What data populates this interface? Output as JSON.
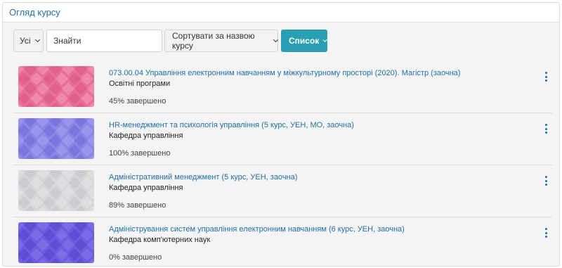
{
  "block_title": "Огляд курсу",
  "toolbar": {
    "filter_label": "Усі",
    "search_placeholder": "Знайти",
    "sort_label": "Сортувати за назвою курсу",
    "view_label": "Список"
  },
  "courses": [
    {
      "title": "073.00.04 Управління електронним навчанням у міжкультурному просторі (2020). Магістр (заочна)",
      "category": "Освітні програми",
      "progress_text": "45% завершено",
      "progress": 45,
      "thumb_colors": [
        "#e96f98",
        "#f29cb8",
        "#d9577f"
      ]
    },
    {
      "title": "HR-менеджмент та психологія управління (5 курс, УЕН, МО, заочна)",
      "category": "Кафедра управління",
      "progress_text": "100% завершено",
      "progress": 100,
      "thumb_colors": [
        "#8b86e6",
        "#a7a2f0",
        "#6f69d6"
      ]
    },
    {
      "title": "Адміністративний менеджмент (5 курс, УЕН, заочна)",
      "category": "Кафедра управління",
      "progress_text": "89% завершено",
      "progress": 89,
      "thumb_colors": [
        "#d4d6d8",
        "#e4e6e8",
        "#c2c5c8"
      ]
    },
    {
      "title": "Адміністрування систем управління електронним навчанням (6 курс, УЕН, заочна)",
      "category": "Кафедра комп'ютерних наук",
      "progress_text": "0% завершено",
      "progress": 0,
      "thumb_colors": [
        "#6c5ce0",
        "#857aea",
        "#5546c8"
      ]
    }
  ]
}
